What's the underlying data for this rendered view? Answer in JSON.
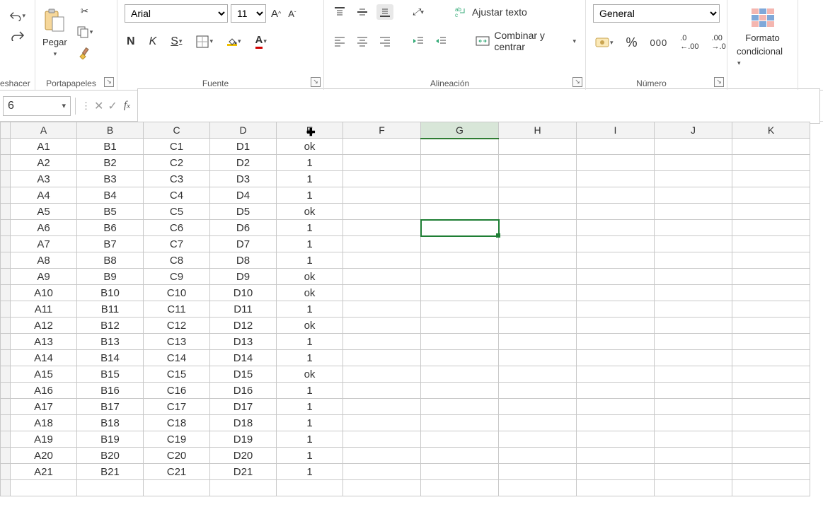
{
  "ribbon": {
    "undo_group": "eshacer",
    "clipboard": {
      "paste": "Pegar",
      "label": "Portapapeles"
    },
    "font": {
      "name": "Arial",
      "size": "11",
      "bold": "N",
      "italic": "K",
      "underline": "S",
      "label": "Fuente"
    },
    "alignment": {
      "wrap": "Ajustar texto",
      "merge": "Combinar y centrar",
      "label": "Alineación"
    },
    "number": {
      "format": "General",
      "percent": "%",
      "thousands": "000",
      "label": "Número"
    },
    "cond": {
      "line1": "Formato",
      "line2": "condicional"
    }
  },
  "namebox": "6",
  "columns": [
    "A",
    "B",
    "C",
    "D",
    "E",
    "F",
    "G",
    "H",
    "I",
    "J",
    "K"
  ],
  "rows": [
    {
      "A": "A1",
      "B": "B1",
      "C": "C1",
      "D": "D1",
      "E": "ok"
    },
    {
      "A": "A2",
      "B": "B2",
      "C": "C2",
      "D": "D2",
      "E": "1"
    },
    {
      "A": "A3",
      "B": "B3",
      "C": "C3",
      "D": "D3",
      "E": "1"
    },
    {
      "A": "A4",
      "B": "B4",
      "C": "C4",
      "D": "D4",
      "E": "1"
    },
    {
      "A": "A5",
      "B": "B5",
      "C": "C5",
      "D": "D5",
      "E": "ok"
    },
    {
      "A": "A6",
      "B": "B6",
      "C": "C6",
      "D": "D6",
      "E": "1"
    },
    {
      "A": "A7",
      "B": "B7",
      "C": "C7",
      "D": "D7",
      "E": "1"
    },
    {
      "A": "A8",
      "B": "B8",
      "C": "C8",
      "D": "D8",
      "E": "1"
    },
    {
      "A": "A9",
      "B": "B9",
      "C": "C9",
      "D": "D9",
      "E": "ok"
    },
    {
      "A": "A10",
      "B": "B10",
      "C": "C10",
      "D": "D10",
      "E": "ok"
    },
    {
      "A": "A11",
      "B": "B11",
      "C": "C11",
      "D": "D11",
      "E": "1"
    },
    {
      "A": "A12",
      "B": "B12",
      "C": "C12",
      "D": "D12",
      "E": "ok"
    },
    {
      "A": "A13",
      "B": "B13",
      "C": "C13",
      "D": "D13",
      "E": "1"
    },
    {
      "A": "A14",
      "B": "B14",
      "C": "C14",
      "D": "D14",
      "E": "1"
    },
    {
      "A": "A15",
      "B": "B15",
      "C": "C15",
      "D": "D15",
      "E": "ok"
    },
    {
      "A": "A16",
      "B": "B16",
      "C": "C16",
      "D": "D16",
      "E": "1"
    },
    {
      "A": "A17",
      "B": "B17",
      "C": "C17",
      "D": "D17",
      "E": "1"
    },
    {
      "A": "A18",
      "B": "B18",
      "C": "C18",
      "D": "D18",
      "E": "1"
    },
    {
      "A": "A19",
      "B": "B19",
      "C": "C19",
      "D": "D19",
      "E": "1"
    },
    {
      "A": "A20",
      "B": "B20",
      "C": "C20",
      "D": "D20",
      "E": "1"
    },
    {
      "A": "A21",
      "B": "B21",
      "C": "C21",
      "D": "D21",
      "E": "1"
    }
  ],
  "selected_cell": "G6",
  "col_widths": {
    "row": 14,
    "A": 94,
    "B": 94,
    "C": 94,
    "D": 94,
    "E": 94,
    "F": 110,
    "G": 110,
    "H": 110,
    "I": 110,
    "J": 110,
    "K": 110
  }
}
